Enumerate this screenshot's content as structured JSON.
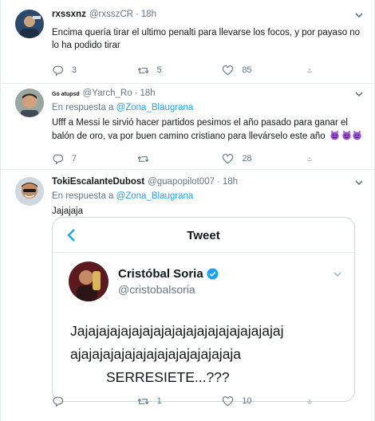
{
  "tweets": [
    {
      "name": "rxssxnz",
      "handle": "@rxsszCR",
      "time": "18h",
      "reply_prefix": "",
      "reply_to": "",
      "text": "Encima quería tirar el ultimo penalti para llevarse los focos, y por payaso no lo ha podido tirar",
      "replies": "3",
      "retweets": "5",
      "likes": "85"
    },
    {
      "name": "Go atupsd",
      "handle": "@Yarch_Ro",
      "time": "18h",
      "reply_prefix": "En respuesta a",
      "reply_to": "@Zona_Blaugrana",
      "text": "Ufff a Messi le sirvió hacer partidos pesimos el año pasado para ganar el balón de oro, va por buen camino cristiano para llevárselo este año",
      "emojis": [
        "smiling-devil",
        "smiling-devil",
        "smiling-devil"
      ],
      "replies": "7",
      "retweets": "",
      "likes": "28"
    },
    {
      "name": "TokiEscalanteDubost",
      "handle": "@guapopilot007",
      "time": "18h",
      "reply_prefix": "En respuesta a",
      "reply_to": "@Zona_Blaugrana",
      "text": "Jajajaja",
      "replies": "",
      "retweets": "1",
      "likes": "10"
    }
  ],
  "embed": {
    "title": "Tweet",
    "name": "Cristóbal Soria",
    "handle": "@cristobalsoria",
    "line1": "Jajajajajajajajajajajajajajajajajajajaj",
    "line2": "ajajajajajajajajajajajajajajaja",
    "line3": "SERRESIETE...???"
  },
  "colors": {
    "link": "#1da1f2",
    "muted": "#657786",
    "text": "#14171a",
    "border": "#e6ecf0"
  },
  "icons": [
    "reply-icon",
    "retweet-icon",
    "like-icon",
    "share-icon",
    "chevron-down-icon",
    "back-arrow-icon",
    "verified-badge-icon",
    "smiling-devil-emoji"
  ]
}
